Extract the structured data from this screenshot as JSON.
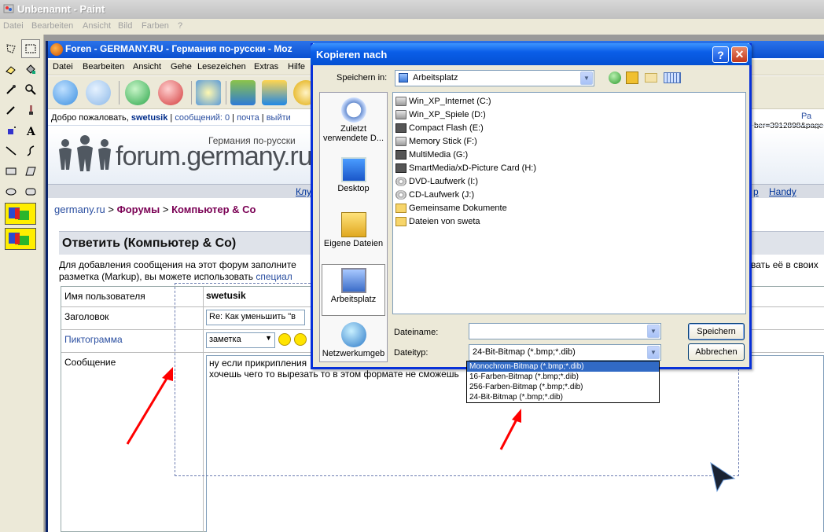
{
  "paint": {
    "title": "Unbenannt - Paint",
    "menu": [
      "Datei",
      "Bearbeiten",
      "Ansicht",
      "Bild",
      "Farben",
      "?"
    ]
  },
  "browser": {
    "title": "Foren - GERMANY.RU - Германия по-русски - Moz",
    "menu": [
      "Datei",
      "Bearbeiten",
      "Ansicht",
      "Gehe",
      "Lesezeichen",
      "Extras",
      "Hilfe"
    ],
    "url_fragment": "ber=3912898&page",
    "right_link": "Ра"
  },
  "forum": {
    "welcome": "Добро пожаловать,",
    "user": "swetusik",
    "messages": "сообщений: 0",
    "mail": "почта",
    "logout": "выйти",
    "logo_text": "forum.germany.ru",
    "logo_sub": "Германия по-русски",
    "nav_left": "Клу",
    "nav_mid": "p",
    "nav_right": "Handy",
    "crumb1": "germany.ru",
    "crumb_sep": ">",
    "crumb2": "Форумы",
    "crumb3": "Компьютер & Co",
    "reply_title": "Ответить (Компьютер & Co)",
    "intro_line1": "Для добавления сообщения на этот форум заполните",
    "intro_line1_end": "вать её в своих",
    "intro_line2": "разметка (Markup), вы можете использовать",
    "intro_link": "специал",
    "form": {
      "user_label": "Имя пользователя",
      "user_value": "swetusik",
      "subject_label": "Заголовок",
      "subject_value": "Re: Как уменьшить \"в",
      "icon_label": "Пиктограмма",
      "icon_value": "заметка",
      "message_label": "Сообщение",
      "message_line1": "ну если прикрипления",
      "message_line2": "хочешь чего то вырезать то в этом формате не сможешь"
    }
  },
  "dialog": {
    "title": "Kopieren nach",
    "save_in_label": "Speichern in:",
    "save_in_value": "Arbeitsplatz",
    "places": [
      "Zuletzt verwendete D...",
      "Desktop",
      "Eigene Dateien",
      "Arbeitsplatz",
      "Netzwerkumgeb"
    ],
    "files": [
      "Win_XP_Internet (C:)",
      "Win_XP_Spiele (D:)",
      "Compact Flash (E:)",
      "Memory Stick (F:)",
      "MultiMedia (G:)",
      "SmartMedia/xD-Picture Card (H:)",
      "DVD-Laufwerk (I:)",
      "CD-Laufwerk (J:)",
      "Gemeinsame Dokumente",
      "Dateien von sweta"
    ],
    "filename_label": "Dateiname:",
    "filename_value": "",
    "filetype_label": "Dateityp:",
    "filetype_value": "24-Bit-Bitmap (*.bmp;*.dib)",
    "save_button": "Speichern",
    "cancel_button": "Abbrechen",
    "filetype_options": [
      "Monochrom-Bitmap (*.bmp;*.dib)",
      "16-Farben-Bitmap (*.bmp;*.dib)",
      "256-Farben-Bitmap (*.bmp;*.dib)",
      "24-Bit-Bitmap (*.bmp;*.dib)"
    ],
    "highlighted_option_index": 0
  },
  "colors": {
    "xp_blue": "#0a5ee8",
    "highlight": "#316ac5",
    "arrow_red": "#ff0000"
  }
}
